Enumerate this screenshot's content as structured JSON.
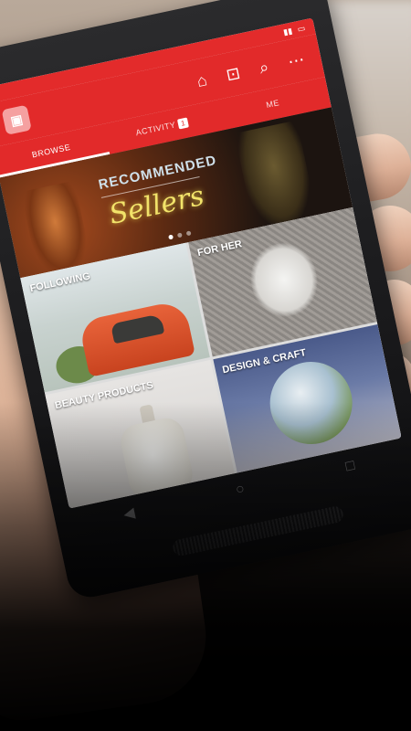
{
  "tabs": [
    {
      "label": "BROWSE",
      "active": true
    },
    {
      "label": "ACTIVITY",
      "badge": "1",
      "active": false
    },
    {
      "label": "ME",
      "active": false
    }
  ],
  "banner": {
    "title": "RECOMMENDED",
    "script": "Sellers"
  },
  "categories": [
    {
      "label": "FOLLOWING"
    },
    {
      "label": "FOR HER"
    },
    {
      "label": "BEAUTY PRODUCTS"
    },
    {
      "label": "DESIGN & CRAFT"
    }
  ],
  "icons": {
    "logo": "bag-logo-icon",
    "toolbar": [
      "shopping-icon",
      "gift-icon",
      "search-icon",
      "more-icon"
    ],
    "nav": [
      "back-icon",
      "home-icon",
      "recents-icon"
    ]
  },
  "colors": {
    "brand_red": "#e22a2a",
    "banner_script": "#f2e36a"
  }
}
